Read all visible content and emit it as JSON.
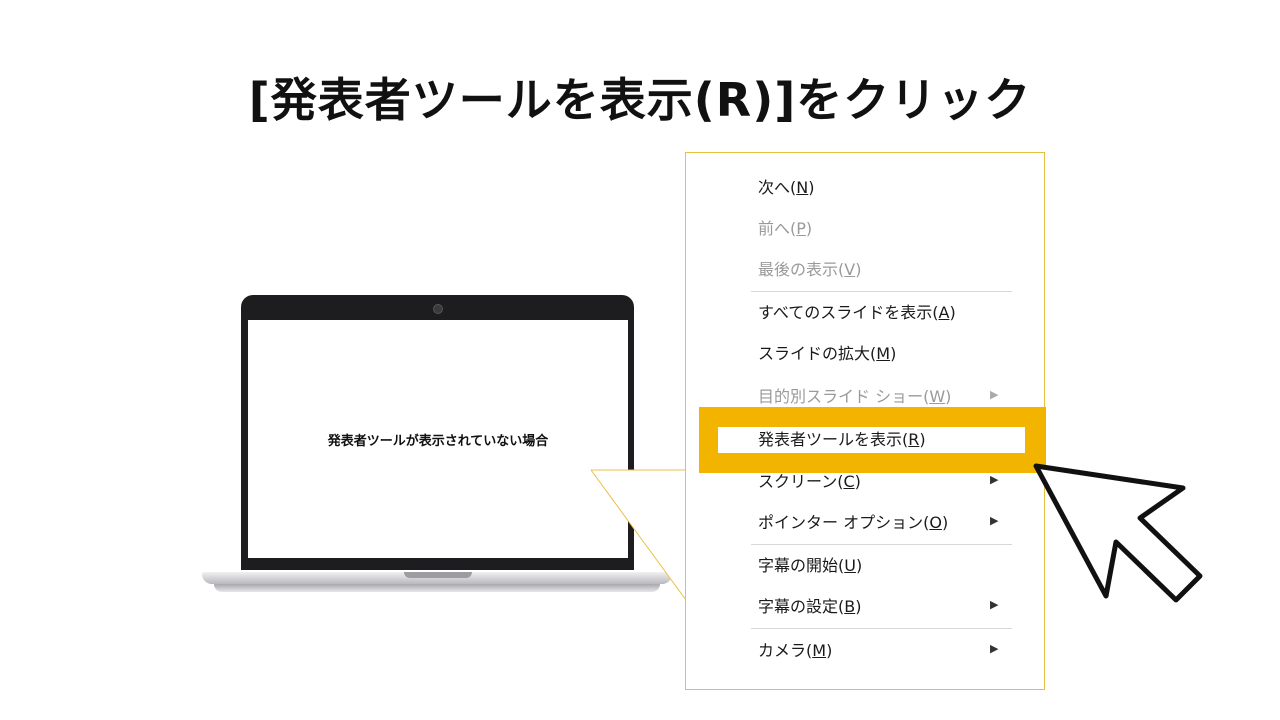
{
  "slide": {
    "title": "[発表者ツールを表示(R)]をクリック"
  },
  "laptop": {
    "screen_text": "発表者ツールが表示されていない場合"
  },
  "context_menu": {
    "items": [
      {
        "text": "次へ(",
        "accel": "N",
        "suffix": ")",
        "enabled": true,
        "submenu": false
      },
      {
        "text": "前へ(",
        "accel": "P",
        "suffix": ")",
        "enabled": false,
        "submenu": false
      },
      {
        "text": "最後の表示(",
        "accel": "V",
        "suffix": ")",
        "enabled": false,
        "submenu": false
      },
      {
        "text": "すべてのスライドを表示(",
        "accel": "A",
        "suffix": ")",
        "enabled": true,
        "submenu": false
      },
      {
        "text": "スライドの拡大(",
        "accel": "M",
        "suffix": ")",
        "enabled": true,
        "submenu": false
      },
      {
        "text": "目的別スライド ショー(",
        "accel": "W",
        "suffix": ")",
        "enabled": false,
        "submenu": true
      },
      {
        "text": "発表者ツールを表示(",
        "accel": "R",
        "suffix": ")",
        "enabled": true,
        "submenu": false,
        "highlighted": true
      },
      {
        "text": "スクリーン(",
        "accel": "C",
        "suffix": ")",
        "enabled": true,
        "submenu": true
      },
      {
        "text": "ポインター オプション(",
        "accel": "O",
        "suffix": ")",
        "enabled": true,
        "submenu": true
      },
      {
        "text": "字幕の開始(",
        "accel": "U",
        "suffix": ")",
        "enabled": true,
        "submenu": false
      },
      {
        "text": "字幕の設定(",
        "accel": "B",
        "suffix": ")",
        "enabled": true,
        "submenu": true
      },
      {
        "text": "カメラ(",
        "accel": "M",
        "suffix": ")",
        "enabled": true,
        "submenu": true
      }
    ],
    "submenu_arrow": "▶"
  },
  "colors": {
    "highlight": "#f3b400",
    "callout_border": "#e8c040"
  },
  "icons": {
    "cursor": "mouse-pointer-icon",
    "submenu": "triangle-right-icon"
  }
}
